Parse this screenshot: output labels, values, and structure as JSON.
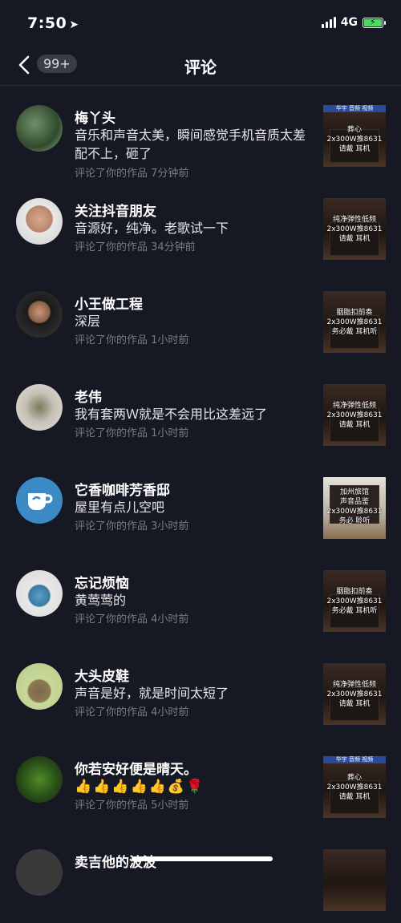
{
  "status": {
    "time": "7:50",
    "network": "4G"
  },
  "nav": {
    "badge": "99+",
    "title": "评论"
  },
  "items": [
    {
      "name": "梅丫头",
      "comment": "音乐和声音太美，瞬间感觉手机音质太差配不上，砸了",
      "meta": "评论了你的作品  7分钟前",
      "thumb": {
        "banner": "华宇  音频  视频",
        "line1": "葬心",
        "line2": "2x300W推8631",
        "line3": "请戴   耳机"
      }
    },
    {
      "name": "关注抖音朋友",
      "comment": "音源好，纯净。老歌试一下",
      "meta": "评论了你的作品  34分钟前",
      "thumb": {
        "line1": "纯净弹性低频",
        "line2": "2x300W推8631",
        "line3": "请戴   耳机"
      }
    },
    {
      "name": "小王做工程",
      "comment": "深层",
      "meta": "评论了你的作品  1小时前",
      "thumb": {
        "line1": "胭脂扣前奏",
        "line2": "2x300W推8631",
        "line3": "务必戴   耳机听"
      }
    },
    {
      "name": "老伟",
      "comment": "我有套两Ｗ就是不会用比这差远了",
      "meta": "评论了你的作品  1小时前",
      "thumb": {
        "line1": "纯净弹性低频",
        "line2": "2x300W推8631",
        "line3": "请戴   耳机"
      }
    },
    {
      "name": "它香咖啡芳香邸",
      "comment": "屋里有点儿空吧",
      "meta": "评论了你的作品  3小时前",
      "thumb": {
        "line1": "加州旅馆",
        "line2": "声音品鉴",
        "line3": "2x300W推8631",
        "line4": "务必   聆听"
      }
    },
    {
      "name": "忘记烦恼",
      "comment": "黄莺莺的",
      "meta": "评论了你的作品  4小时前",
      "thumb": {
        "line1": "胭脂扣前奏",
        "line2": "2x300W推8631",
        "line3": "务必戴   耳机听"
      }
    },
    {
      "name": "大头皮鞋",
      "comment": "声音是好，就是时间太短了",
      "meta": "评论了你的作品  4小时前",
      "thumb": {
        "line1": "纯净弹性低频",
        "line2": "2x300W推8631",
        "line3": "请戴   耳机"
      }
    },
    {
      "name": "你若安好便是晴天。",
      "comment": "👍👍👍👍👍💰🌹",
      "meta": "评论了你的作品  5小时前",
      "thumb": {
        "banner": "华宇  音频  视频",
        "line1": "葬心",
        "line2": "2x300W推8631",
        "line3": "请戴   耳机"
      }
    },
    {
      "name": "卖吉他的波波"
    }
  ]
}
